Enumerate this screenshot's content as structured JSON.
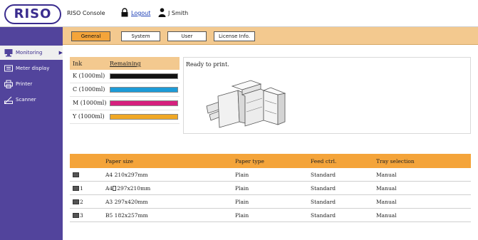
{
  "header": {
    "logo": "RISO",
    "console_title": "RISO Console",
    "logout_label": "Logout",
    "user_name": "J Smith"
  },
  "sidebar": {
    "items": [
      {
        "label": "Monitoring",
        "icon": "monitoring-icon",
        "active": true
      },
      {
        "label": "Meter display",
        "icon": "meter-icon",
        "active": false
      },
      {
        "label": "Printer",
        "icon": "printer-icon",
        "active": false
      },
      {
        "label": "Scanner",
        "icon": "scanner-icon",
        "active": false
      }
    ]
  },
  "tabs": [
    {
      "label": "General",
      "active": true
    },
    {
      "label": "System",
      "active": false
    },
    {
      "label": "User",
      "active": false
    },
    {
      "label": "License Info.",
      "active": false
    }
  ],
  "ink": {
    "col_ink": "Ink",
    "col_remaining": "Remaining",
    "items": [
      {
        "label": "K (1000ml)",
        "color": "#111111",
        "remaining": 1.0
      },
      {
        "label": "C (1000ml)",
        "color": "#1d9bd7",
        "remaining": 1.0
      },
      {
        "label": "M (1000ml)",
        "color": "#d6207e",
        "remaining": 1.0
      },
      {
        "label": "Y (1000ml)",
        "color": "#f0a825",
        "remaining": 1.0
      }
    ]
  },
  "status": {
    "text": "Ready to print."
  },
  "paper": {
    "headers": {
      "size": "Paper size",
      "type": "Paper type",
      "feed": "Feed ctrl.",
      "tray": "Tray selection"
    },
    "rows": [
      {
        "tray_label": "",
        "size": "A4 210x297mm",
        "type": "Plain",
        "feed": "Standard",
        "tray": "Manual",
        "orient_icon": false
      },
      {
        "tray_label": "1",
        "size": "A4",
        "size_suffix": "297x210mm",
        "type": "Plain",
        "feed": "Standard",
        "tray": "Manual",
        "orient_icon": true
      },
      {
        "tray_label": "2",
        "size": "A3 297x420mm",
        "type": "Plain",
        "feed": "Standard",
        "tray": "Manual",
        "orient_icon": false
      },
      {
        "tray_label": "3",
        "size": "B5 182x257mm",
        "type": "Plain",
        "feed": "Standard",
        "tray": "Manual",
        "orient_icon": false
      }
    ]
  }
}
